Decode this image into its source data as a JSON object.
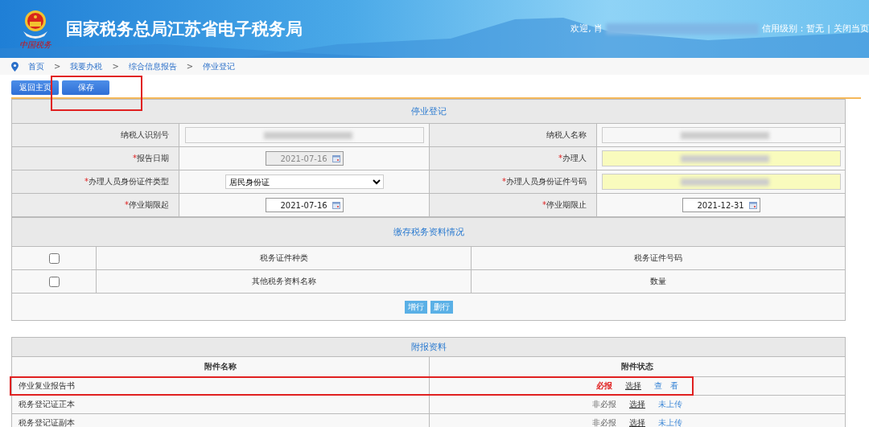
{
  "header": {
    "logo_caption": "中国税务",
    "title": "国家税务总局江苏省电子税务局",
    "welcome": "欢迎, 肖",
    "credit": "信用级别：暂无",
    "separator": "|",
    "close": "关闭当页"
  },
  "breadcrumb": [
    "首页",
    "我要办税",
    "综合信息报告",
    "停业登记"
  ],
  "breadcrumb_separator": ">",
  "toolbar": [
    {
      "label": "返回主页",
      "highlighted": false
    },
    {
      "label": "保存",
      "highlighted": true
    }
  ],
  "form": {
    "title": "停业登记",
    "required_marker": "*",
    "fields": [
      {
        "label": "纳税人识别号",
        "required": false,
        "kind": "text",
        "redacted": true,
        "yellow": false
      },
      {
        "label": "纳税人名称",
        "required": false,
        "kind": "text",
        "redacted": true,
        "yellow": false
      },
      {
        "label": "报告日期",
        "required": true,
        "kind": "date",
        "value": "2021-07-16",
        "disabled": true
      },
      {
        "label": "办理人",
        "required": true,
        "kind": "text",
        "redacted": true,
        "yellow": true
      },
      {
        "label": "办理人员身份证件类型",
        "required": true,
        "kind": "select",
        "value": "居民身份证"
      },
      {
        "label": "办理人员身份证件号码",
        "required": true,
        "kind": "text",
        "redacted": true,
        "yellow": true
      },
      {
        "label": "停业期限起",
        "required": true,
        "kind": "date",
        "value": "2021-07-16",
        "disabled": false
      },
      {
        "label": "停业期限止",
        "required": true,
        "kind": "date",
        "value": "2021-12-31",
        "disabled": false
      }
    ]
  },
  "documents": {
    "title": "缴存税务资料情况",
    "rows": [
      {
        "checked": false,
        "column_1": "税务证件种类",
        "column_2": "税务证件号码"
      },
      {
        "checked": false,
        "column_1": "其他税务资料名称",
        "column_2": "数量"
      }
    ],
    "buttons": [
      "增行",
      "删行"
    ]
  },
  "attachments": {
    "title": "附报资料",
    "columns": [
      "附件名称",
      "附件状态"
    ],
    "rows": [
      {
        "name": "停业复业报告书",
        "status": "必报",
        "required": true,
        "action": "选择",
        "view": "查　看",
        "highlighted": true
      },
      {
        "name": "税务登记证正本",
        "status": "非必报",
        "required": false,
        "action": "选择",
        "view": "未上传",
        "highlighted": false
      },
      {
        "name": "税务登记证副本",
        "status": "非必报",
        "required": false,
        "action": "选择",
        "view": "未上传",
        "highlighted": false
      }
    ]
  }
}
